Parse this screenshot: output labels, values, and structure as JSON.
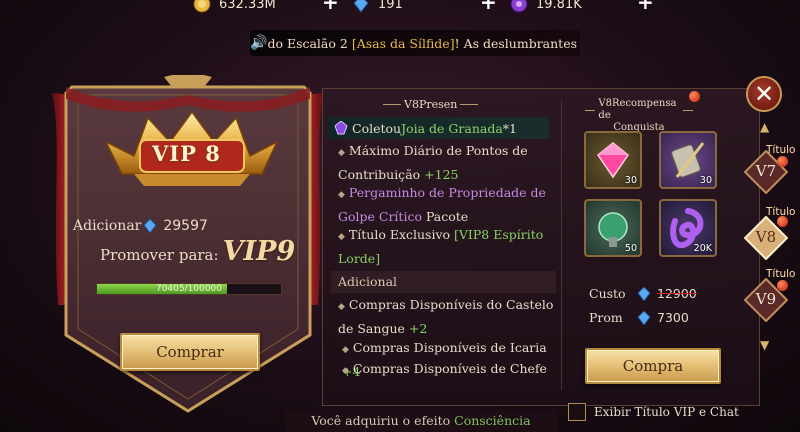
{
  "resources": [
    {
      "icon": "gold-coin-icon",
      "value": "632.33M"
    },
    {
      "icon": "blue-crystal-icon",
      "value": "191"
    },
    {
      "icon": "purple-gem-icon",
      "value": "19.81K"
    }
  ],
  "marquee": {
    "prefix": "do Escalão 2 ",
    "highlight": "[Asas da Sílfide]",
    "suffix": "! As deslumbrantes /"
  },
  "vip_badge": {
    "label": "VIP 8",
    "add_label": "Adicionar",
    "add_value": "29597",
    "promote_label": "Promover para:",
    "promote_level": "VIP9",
    "progress_text": "70405/100000",
    "progress_fraction": 0.70405,
    "buy_button": "Comprar"
  },
  "privileges": {
    "title": "V8Presen",
    "collect_prefix": "Coletou ",
    "collect_item": "Joia de Granada",
    "collect_suffix": "*1",
    "items": [
      {
        "line1": "Máximo Diário de Pontos de",
        "line2": "Contribuição ",
        "green": "+125"
      },
      {
        "purple": "Pergaminho de Propriedade de",
        "purple2": "Golpe Crítico",
        "rest": " Pacote"
      },
      {
        "line1": "Título Exclusivo ",
        "green": "[VIP8 Espírito",
        "green2": "Lorde]"
      }
    ],
    "additional_header": "Adicional",
    "additional": [
      {
        "line1": "Compras Disponíveis do Castelo",
        "line2": "de Sangue ",
        "green": "+2"
      },
      {
        "text": "Compras Disponíveis de Icaria ",
        "green": "+4"
      },
      {
        "text": "Compras Disponíveis de Chefe",
        "green": ""
      }
    ]
  },
  "rewards": {
    "title": "V8Recompensa de",
    "title2": "Conquista",
    "items": [
      {
        "icon": "pink-diamond-icon",
        "count": "30"
      },
      {
        "icon": "scroll-sword-icon",
        "count": "30"
      },
      {
        "icon": "green-chalice-icon",
        "count": "50"
      },
      {
        "icon": "purple-swirl-icon",
        "count": "20K"
      }
    ],
    "cost_label": "Custo",
    "cost_value": "12900",
    "promo_label": "Prom",
    "promo_value": "7300",
    "buy_button": "Compra"
  },
  "tiers": [
    {
      "label": "V7",
      "tag": "Título"
    },
    {
      "label": "V8",
      "tag": "Título"
    },
    {
      "label": "V9",
      "tag": "Título"
    }
  ],
  "footer": {
    "effect_prefix": "Você adquiriu o efeito ",
    "effect_name": "Consciência",
    "checkbox_label": "Exibir Título VIP e Chat"
  },
  "colors": {
    "gold": "#e6c27a",
    "green": "#86d062",
    "purple": "#c68ae2",
    "panel": "#2c1822"
  }
}
